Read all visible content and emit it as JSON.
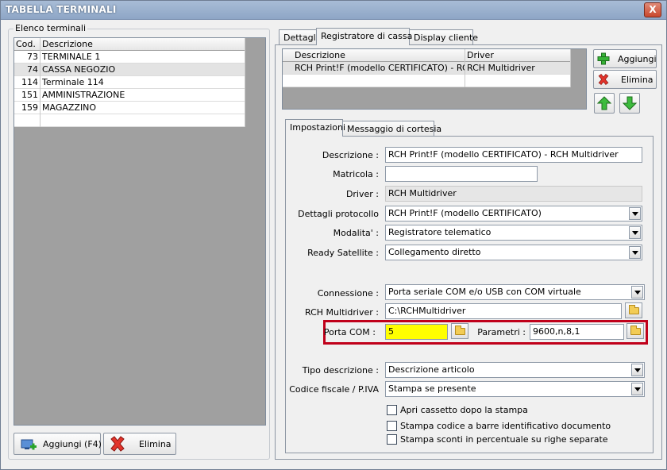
{
  "window": {
    "title": "TABELLA TERMINALI",
    "close_glyph": "X"
  },
  "left": {
    "group_label": "Elenco terminali",
    "columns": [
      "Cod.",
      "Descrizione"
    ],
    "rows": [
      {
        "code": "73",
        "desc": "TERMINALE 1"
      },
      {
        "code": "74",
        "desc": "CASSA NEGOZIO"
      },
      {
        "code": "114",
        "desc": "Terminale 114"
      },
      {
        "code": "151",
        "desc": "AMMINISTRAZIONE"
      },
      {
        "code": "159",
        "desc": "MAGAZZINO"
      },
      {
        "code": "",
        "desc": ""
      }
    ],
    "add_button": "Aggiungi (F4)",
    "delete_button": "Elimina"
  },
  "top_tabs": [
    "Dettagli",
    "Registratore di cassa",
    "Display cliente"
  ],
  "drivers_grid": {
    "columns": [
      "Descrizione",
      "Driver"
    ],
    "rows": [
      {
        "desc": "RCH Print!F (modello CERTIFICATO) - RC...",
        "driver": "RCH Multidriver"
      },
      {
        "desc": "",
        "driver": ""
      }
    ],
    "add_button": "Aggiungi",
    "delete_button": "Elimina"
  },
  "sub_tabs": [
    "Impostazioni",
    "Messaggio di cortesia"
  ],
  "form": {
    "descrizione_label": "Descrizione :",
    "descrizione_value": "RCH Print!F (modello CERTIFICATO) - RCH Multidriver",
    "matricola_label": "Matricola :",
    "matricola_value": "",
    "driver_label": "Driver :",
    "driver_value": "RCH Multidriver",
    "protocollo_label": "Dettagli protocollo",
    "protocollo_value": "RCH Print!F (modello CERTIFICATO)",
    "modalita_label": "Modalita' :",
    "modalita_value": "Registratore telematico",
    "ready_label": "Ready Satellite :",
    "ready_value": "Collegamento diretto",
    "connessione_label": "Connessione :",
    "connessione_value": "Porta seriale COM e/o USB con COM virtuale",
    "multidriver_label": "RCH Multidriver :",
    "multidriver_value": "C:\\RCHMultidriver",
    "porta_label": "Porta COM :",
    "porta_value": "5",
    "parametri_label": "Parametri :",
    "parametri_value": "9600,n,8,1",
    "tipo_label": "Tipo descrizione :",
    "tipo_value": "Descrizione articolo",
    "codfisc_label": "Codice fiscale / P.IVA",
    "codfisc_value": "Stampa se presente",
    "chk_cassetto": "Apri cassetto dopo la stampa",
    "chk_barre": "Stampa codice a barre identificativo documento",
    "chk_sconti": "Stampa sconti in percentuale su righe separate"
  }
}
